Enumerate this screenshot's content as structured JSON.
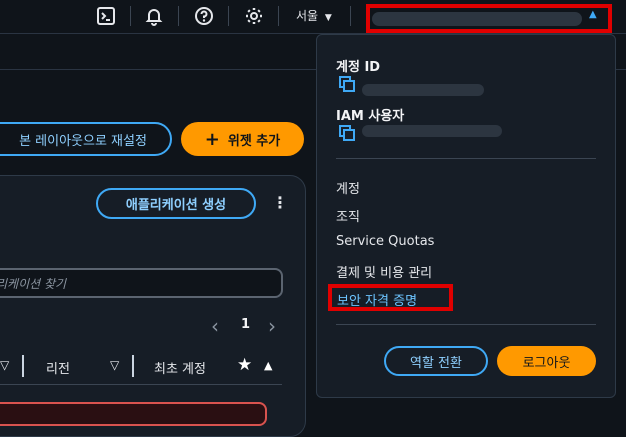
{
  "topbar": {
    "cloudshell_icon": "terminal-icon",
    "notification_icon": "bell-icon",
    "help_icon": "help-icon",
    "settings_icon": "gear-icon",
    "region_label": "서울",
    "region_caret": "▼",
    "account_caret": "▲"
  },
  "main": {
    "reset_layout_label": "본 레이아웃으로 재설정",
    "add_widget_label": "위젯 추가",
    "add_widget_icon": "+",
    "create_app_label": "애플리케이션 생성",
    "more_icon": "⋮",
    "search_placeholder": "리케이션 찾기",
    "pagination": {
      "prev": "‹",
      "page": "1",
      "next": "›"
    },
    "columns": [
      {
        "label": "",
        "sort": "▽"
      },
      {
        "label": "리전",
        "sort": "▽"
      },
      {
        "label": "최초 계정",
        "sort": ""
      }
    ],
    "star_icon": "★",
    "sort_up": "▲"
  },
  "dropdown": {
    "account_id_label": "계정 ID",
    "iam_user_label": "IAM 사용자",
    "items": [
      {
        "label": "계정"
      },
      {
        "label": "조직"
      },
      {
        "label": "Service Quotas"
      },
      {
        "label": "결제 및 비용 관리"
      },
      {
        "label": "보안 자격 증명"
      }
    ],
    "switch_role_label": "역할 전환",
    "signout_label": "로그아웃"
  },
  "colors": {
    "accent_blue": "#3fa9f5",
    "accent_orange": "#ff9900",
    "highlight_red": "#e00000",
    "link_blue": "#6cc4ff"
  }
}
